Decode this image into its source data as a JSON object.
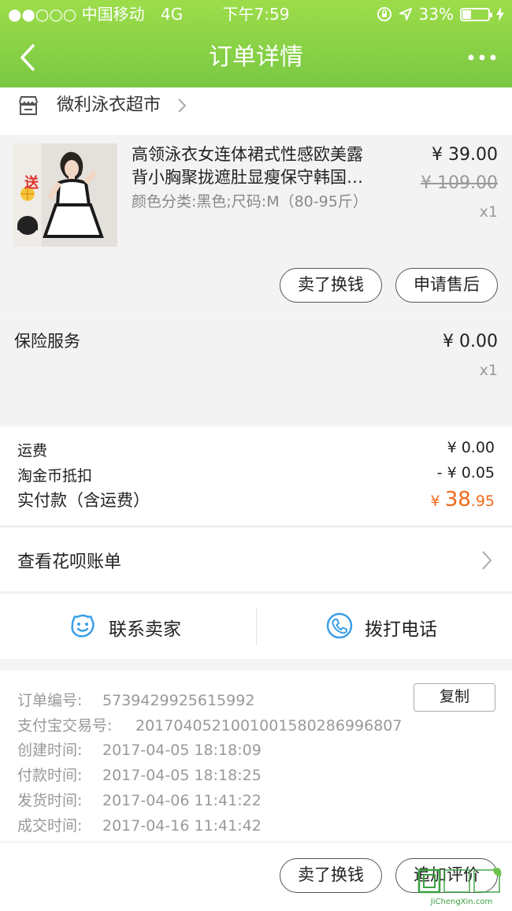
{
  "status_bar": {
    "carrier": "●●○○○ 中国移动",
    "network": "4G",
    "time": "下午7:59",
    "battery": "33%",
    "battery_level": 0.33
  },
  "nav": {
    "title": "订单详情"
  },
  "shop": {
    "name": "微利泳衣超市"
  },
  "product": {
    "title_line1": "高领泳衣女连体裙式性感欧美露",
    "title_line2": "背小胸聚拢遮肚显瘦保守韩国…",
    "sku": "颜色分类:黑色;尺码:M（80-95斤）",
    "price": "¥ 39.00",
    "original_price": "¥ 109.00",
    "quantity": "x1",
    "thumb_badge": "送",
    "sell_label": "卖了换钱",
    "aftersale_label": "申请售后"
  },
  "insurance": {
    "label": "保险服务",
    "price": "¥ 0.00",
    "quantity": "x1"
  },
  "fees": {
    "shipping_label": "运费",
    "shipping_value": "¥ 0.00",
    "coin_label": "淘金币抵扣",
    "coin_value": "- ¥ 0.05",
    "paid_label": "实付款（含运费）",
    "paid_currency": "¥ ",
    "paid_int": "38",
    "paid_dec": ".95"
  },
  "huabei": {
    "label": "查看花呗账单"
  },
  "contact": {
    "seller_label": "联系卖家",
    "phone_label": "拨打电话"
  },
  "order_info": {
    "order_no_label": "订单编号:",
    "order_no": "5739429925615992",
    "copy_label": "复制",
    "alipay_label": "支付宝交易号:",
    "alipay_no": "2017040521001001580286996807",
    "created_label": "创建时间:",
    "created": "2017-04-05 18:18:09",
    "paid_label": "付款时间:",
    "paid": "2017-04-05 18:18:25",
    "shipped_label": "发货时间:",
    "shipped": "2017-04-06 11:41:22",
    "completed_label": "成交时间:",
    "completed": "2017-04-16 11:41:42"
  },
  "bottom_actions": {
    "sell_label": "卖了换钱",
    "review_label": "追加评价"
  },
  "watermark": {
    "text": "JiChengXin.com"
  },
  "colors": {
    "header_green": "#79c843",
    "price_orange": "#f26a1b",
    "icon_blue": "#3a9ee8"
  }
}
